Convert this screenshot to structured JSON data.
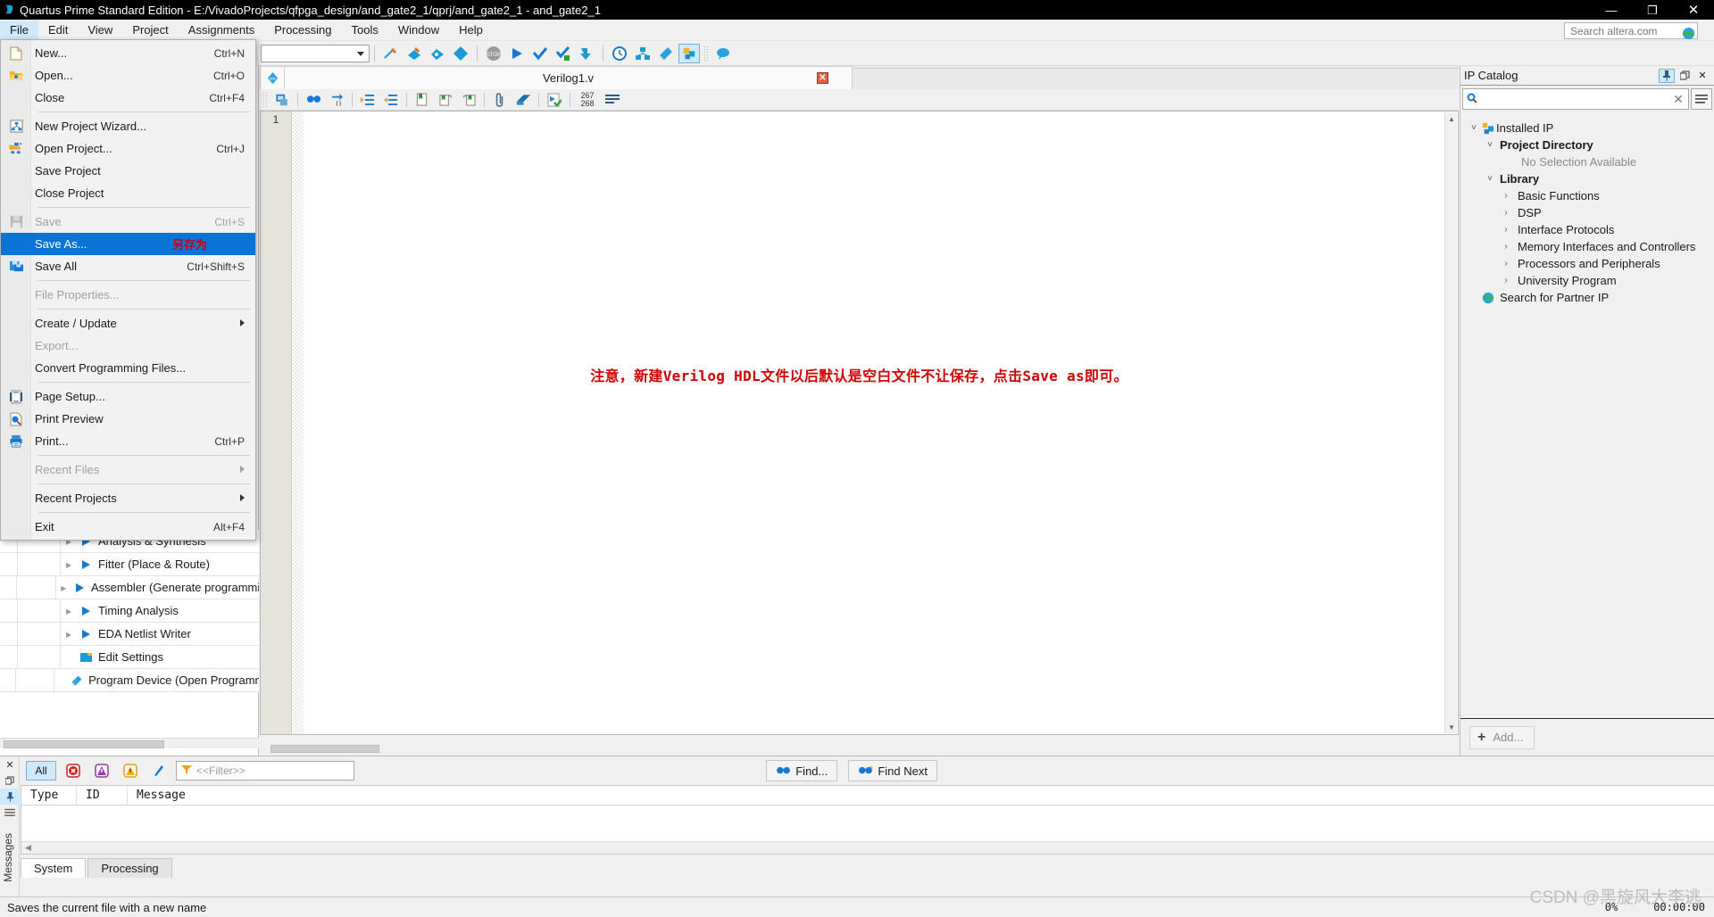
{
  "window": {
    "title": "Quartus Prime Standard Edition - E:/VivadoProjects/qfpga_design/and_gate2_1/qprj/and_gate2_1 - and_gate2_1",
    "app_icon": "quartus-logo-icon",
    "minimize": "—",
    "maximize": "❐",
    "close": "✕"
  },
  "menubar": {
    "items": [
      {
        "label": "File",
        "active": true
      },
      {
        "label": "Edit",
        "active": false
      },
      {
        "label": "View",
        "active": false
      },
      {
        "label": "Project",
        "active": false
      },
      {
        "label": "Assignments",
        "active": false
      },
      {
        "label": "Processing",
        "active": false
      },
      {
        "label": "Tools",
        "active": false
      },
      {
        "label": "Window",
        "active": false
      },
      {
        "label": "Help",
        "active": false
      }
    ],
    "search_placeholder": "Search altera.com"
  },
  "file_menu": {
    "rows": [
      {
        "type": "item",
        "label": "New...",
        "accel": "Ctrl+N",
        "icon": "new-file-icon",
        "disabled": false
      },
      {
        "type": "item",
        "label": "Open...",
        "accel": "Ctrl+O",
        "icon": "open-folder-icon",
        "disabled": false
      },
      {
        "type": "item",
        "label": "Close",
        "accel": "Ctrl+F4",
        "icon": "",
        "disabled": false
      },
      {
        "type": "sep"
      },
      {
        "type": "item",
        "label": "New Project Wizard...",
        "accel": "",
        "icon": "new-project-icon",
        "disabled": false
      },
      {
        "type": "item",
        "label": "Open Project...",
        "accel": "Ctrl+J",
        "icon": "open-project-icon",
        "disabled": false
      },
      {
        "type": "item",
        "label": "Save Project",
        "accel": "",
        "icon": "",
        "disabled": false
      },
      {
        "type": "item",
        "label": "Close Project",
        "accel": "",
        "icon": "",
        "disabled": false
      },
      {
        "type": "sep"
      },
      {
        "type": "item",
        "label": "Save",
        "accel": "Ctrl+S",
        "icon": "save-disk-icon",
        "disabled": true
      },
      {
        "type": "item",
        "label": "Save As...",
        "accel": "",
        "icon": "",
        "disabled": false,
        "highlight": true,
        "note": "另存为"
      },
      {
        "type": "item",
        "label": "Save All",
        "accel": "Ctrl+Shift+S",
        "icon": "save-all-icon",
        "disabled": false
      },
      {
        "type": "sep"
      },
      {
        "type": "item",
        "label": "File Properties...",
        "accel": "",
        "icon": "",
        "disabled": true
      },
      {
        "type": "sep"
      },
      {
        "type": "item",
        "label": "Create / Update",
        "accel": "",
        "icon": "",
        "disabled": false,
        "submenu": true
      },
      {
        "type": "item",
        "label": "Export...",
        "accel": "",
        "icon": "",
        "disabled": true
      },
      {
        "type": "item",
        "label": "Convert Programming Files...",
        "accel": "",
        "icon": "",
        "disabled": false
      },
      {
        "type": "sep"
      },
      {
        "type": "item",
        "label": "Page Setup...",
        "accel": "",
        "icon": "page-setup-icon",
        "disabled": false
      },
      {
        "type": "item",
        "label": "Print Preview",
        "accel": "",
        "icon": "print-preview-icon",
        "disabled": false
      },
      {
        "type": "item",
        "label": "Print...",
        "accel": "Ctrl+P",
        "icon": "printer-icon",
        "disabled": false
      },
      {
        "type": "sep"
      },
      {
        "type": "item",
        "label": "Recent Files",
        "accel": "",
        "icon": "",
        "disabled": true,
        "submenu": true
      },
      {
        "type": "sep"
      },
      {
        "type": "item",
        "label": "Recent Projects",
        "accel": "",
        "icon": "",
        "disabled": false,
        "submenu": true
      },
      {
        "type": "sep"
      },
      {
        "type": "item",
        "label": "Exit",
        "accel": "Alt+F4",
        "icon": "",
        "disabled": false
      }
    ]
  },
  "tasks": {
    "rows": [
      {
        "label": "Analysis & Synthesis",
        "icon": "run-arrow-icon",
        "expander": true
      },
      {
        "label": "Fitter (Place & Route)",
        "icon": "run-arrow-icon",
        "expander": true
      },
      {
        "label": "Assembler (Generate programming",
        "icon": "run-arrow-icon",
        "expander": true
      },
      {
        "label": "Timing Analysis",
        "icon": "run-arrow-icon",
        "expander": true
      },
      {
        "label": "EDA Netlist Writer",
        "icon": "run-arrow-icon",
        "expander": true
      },
      {
        "label": "Edit Settings",
        "icon": "settings-icon",
        "expander": false
      },
      {
        "label": "Program Device (Open Programmer)",
        "icon": "program-device-icon",
        "expander": false
      }
    ]
  },
  "editor": {
    "tab_icon": "verilog-file-icon",
    "tab_label": "Verilog1.v",
    "tab_close": "✕",
    "line_numbers": [
      "1"
    ],
    "annotation": "注意，新建Verilog HDL文件以后默认是空白文件不让保存，点击Save as即可。",
    "annotation_color": "#d40000",
    "toolbar_icons": [
      "insert-template-icon",
      "find-icon",
      "goto-line-icon",
      "increase-indent-icon",
      "decrease-indent-icon",
      "bookmark-icon",
      "next-bookmark-icon",
      "prev-bookmark-icon",
      "clip-icon",
      "comment-icon",
      "run-check-icon",
      "line-count-icon",
      "word-wrap-icon"
    ],
    "line_count_top": "267",
    "line_count_bottom": "268"
  },
  "toolbar": {
    "icons": [
      "new-icon",
      "flow-summary-icon",
      "compile-icon",
      "pin-planner-icon",
      "stop-icon",
      "start-compilation-icon",
      "analysis-synthesis-icon",
      "fitter-icon",
      "assembler-icon",
      "timing-analyzer-icon",
      "pin-planner2-icon",
      "programmer-icon",
      "ip-catalog-icon",
      "chat-icon"
    ]
  },
  "ip_catalog": {
    "title": "IP Catalog",
    "pin_icon": "pin-icon",
    "undock_icon": "undock-icon",
    "close_icon": "✕",
    "search_value": "",
    "search_placeholder": "",
    "search_icon": "magnifier-icon",
    "clear_icon": "✕",
    "menu_icon": "hamburger-icon",
    "tree": [
      {
        "label": "Installed IP",
        "indent": 0,
        "expander": "v",
        "icon": "installed-ip-icon",
        "bold": false,
        "muted": false
      },
      {
        "label": "Project Directory",
        "indent": 1,
        "expander": "v",
        "icon": "",
        "bold": true,
        "muted": false
      },
      {
        "label": "No Selection Available",
        "indent": 3,
        "expander": "",
        "icon": "",
        "bold": false,
        "muted": true
      },
      {
        "label": "Library",
        "indent": 1,
        "expander": "v",
        "icon": "",
        "bold": true,
        "muted": false
      },
      {
        "label": "Basic Functions",
        "indent": 2,
        "expander": ">",
        "icon": "",
        "bold": false,
        "muted": false
      },
      {
        "label": "DSP",
        "indent": 2,
        "expander": ">",
        "icon": "",
        "bold": false,
        "muted": false
      },
      {
        "label": "Interface Protocols",
        "indent": 2,
        "expander": ">",
        "icon": "",
        "bold": false,
        "muted": false
      },
      {
        "label": "Memory Interfaces and Controllers",
        "indent": 2,
        "expander": ">",
        "icon": "",
        "bold": false,
        "muted": false
      },
      {
        "label": "Processors and Peripherals",
        "indent": 2,
        "expander": ">",
        "icon": "",
        "bold": false,
        "muted": false
      },
      {
        "label": "University Program",
        "indent": 2,
        "expander": ">",
        "icon": "",
        "bold": false,
        "muted": false
      },
      {
        "label": "Search for Partner IP",
        "indent": 1,
        "expander": "",
        "icon": "globe-icon",
        "bold": false,
        "muted": false
      }
    ],
    "add_button": "Add..."
  },
  "messages": {
    "panel_label": "Messages",
    "rail_icons": [
      "close-icon",
      "undock-icon",
      "pin-icon",
      "hamburger-icon"
    ],
    "filter_buttons": [
      {
        "label": "All",
        "name": "filter-all",
        "active": true
      },
      {
        "label": "",
        "name": "error-filter-icon",
        "active": false
      },
      {
        "label": "",
        "name": "critical-warning-filter-icon",
        "active": false
      },
      {
        "label": "",
        "name": "warning-filter-icon",
        "active": false
      },
      {
        "label": "",
        "name": "info-filter-icon",
        "active": false
      }
    ],
    "filter_placeholder": "<<Filter>>",
    "filter_value": "",
    "find_label": "Find...",
    "find_next_label": "Find Next",
    "columns": [
      "Type",
      "ID",
      "Message"
    ],
    "rows": [],
    "tabs": [
      {
        "label": "System",
        "active": true
      },
      {
        "label": "Processing",
        "active": false
      }
    ]
  },
  "statusbar": {
    "hint": "Saves the current file with a new name",
    "progress": "0%",
    "elapsed": "00:00:00"
  },
  "watermark": "CSDN @黑旋风大李逃",
  "colors": {
    "accent": "#0a74d6",
    "highlight_bg": "#cfe8fb",
    "annotation_red": "#d40000",
    "titlebar_bg": "#000000",
    "panel_bg": "#f0f0f0"
  }
}
